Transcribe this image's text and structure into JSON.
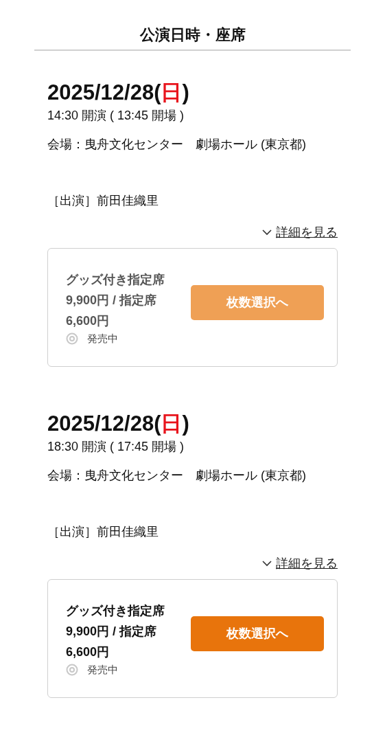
{
  "title": "公演日時・座席",
  "performances": [
    {
      "date_prefix": "2025/12/28(",
      "weekday": "日",
      "date_suffix": ")",
      "time": "14:30 開演 ( 13:45 開場 )",
      "venue": "会場：曳舟文化センター　劇場ホール (東京都)",
      "cast": "［出演］前田佳織里",
      "details_link": "詳細を見る",
      "ticket": {
        "dimmed": true,
        "seat_line_1": "グッズ付き指定席",
        "seat_line_2": "9,900円 / 指定席",
        "seat_line_3": "6,600円",
        "status": "発売中",
        "button": "枚数選択へ"
      }
    },
    {
      "date_prefix": "2025/12/28(",
      "weekday": "日",
      "date_suffix": ")",
      "time": "18:30 開演 ( 17:45 開場 )",
      "venue": "会場：曳舟文化センター　劇場ホール (東京都)",
      "cast": "［出演］前田佳織里",
      "details_link": "詳細を見る",
      "ticket": {
        "dimmed": false,
        "seat_line_1": "グッズ付き指定席",
        "seat_line_2": "9,900円 / 指定席",
        "seat_line_3": "6,600円",
        "status": "発売中",
        "button": "枚数選択へ"
      }
    }
  ]
}
